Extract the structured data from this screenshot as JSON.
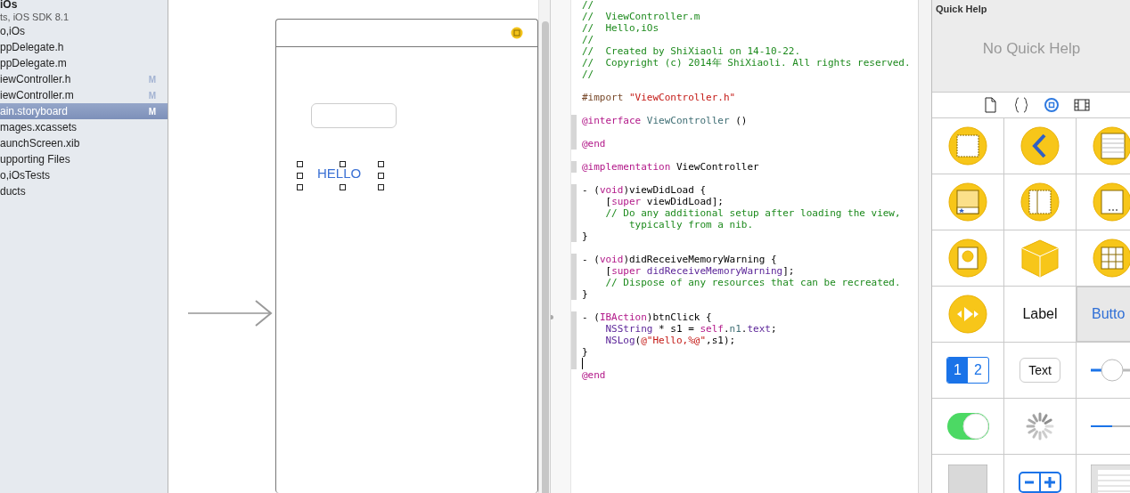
{
  "navigator": {
    "project_title": "iOs",
    "project_subtitle": "ts, iOS SDK 8.1",
    "items": [
      {
        "name": "o,iOs",
        "selected": false
      },
      {
        "name": "ppDelegate.h",
        "selected": false
      },
      {
        "name": "ppDelegate.m",
        "selected": false
      },
      {
        "name": "iewController.h",
        "badge": "M",
        "selected": false
      },
      {
        "name": "iewController.m",
        "badge": "M",
        "selected": false
      },
      {
        "name": "ain.storyboard",
        "badge": "M",
        "selected": true
      },
      {
        "name": "mages.xcassets",
        "selected": false
      },
      {
        "name": "aunchScreen.xib",
        "selected": false
      },
      {
        "name": "upporting Files",
        "selected": false
      },
      {
        "name": "o,iOsTests",
        "selected": false
      },
      {
        "name": "ducts",
        "selected": false
      }
    ]
  },
  "storyboard": {
    "label_text": "HELLO",
    "label_selected": true
  },
  "editor": {
    "lines": [
      {
        "changed": false,
        "tokens": [
          {
            "kind": "comment",
            "text": "//"
          }
        ]
      },
      {
        "changed": false,
        "tokens": [
          {
            "kind": "comment",
            "text": "//  ViewController.m"
          }
        ]
      },
      {
        "changed": false,
        "tokens": [
          {
            "kind": "comment",
            "text": "//  Hello,iOs"
          }
        ]
      },
      {
        "changed": false,
        "tokens": [
          {
            "kind": "comment",
            "text": "//"
          }
        ]
      },
      {
        "changed": false,
        "tokens": [
          {
            "kind": "comment",
            "text": "//  Created by ShiXiaoli on 14-10-22."
          }
        ]
      },
      {
        "changed": false,
        "tokens": [
          {
            "kind": "comment",
            "text": "//  Copyright (c) 2014年 ShiXiaoli. All rights reserved."
          }
        ]
      },
      {
        "changed": false,
        "tokens": [
          {
            "kind": "comment",
            "text": "//"
          }
        ]
      },
      {
        "changed": false
      },
      {
        "changed": false,
        "tokens": [
          {
            "kind": "preproc",
            "text": "#import "
          },
          {
            "kind": "string",
            "text": "\"ViewController.h\""
          }
        ]
      },
      {
        "changed": false
      },
      {
        "changed": true,
        "tokens": [
          {
            "kind": "keyword",
            "text": "@interface"
          },
          {
            "kind": "project",
            "text": " ViewController"
          },
          {
            "kind": "plain",
            "text": " ()"
          }
        ]
      },
      {
        "changed": true
      },
      {
        "changed": true,
        "tokens": [
          {
            "kind": "keyword",
            "text": "@end"
          }
        ]
      },
      {
        "changed": false
      },
      {
        "changed": true,
        "tokens": [
          {
            "kind": "keyword",
            "text": "@implementation"
          },
          {
            "kind": "plain",
            "text": " ViewController"
          }
        ]
      },
      {
        "changed": false
      },
      {
        "changed": true,
        "tokens": [
          {
            "kind": "plain",
            "text": "- ("
          },
          {
            "kind": "keyword",
            "text": "void"
          },
          {
            "kind": "plain",
            "text": ")viewDidLoad {"
          }
        ]
      },
      {
        "changed": true,
        "tokens": [
          {
            "kind": "plain",
            "text": "    ["
          },
          {
            "kind": "keyword",
            "text": "super"
          },
          {
            "kind": "plain",
            "text": " viewDidLoad];"
          }
        ]
      },
      {
        "changed": true,
        "tokens": [
          {
            "kind": "comment",
            "text": "    // Do any additional setup after loading the view,"
          }
        ]
      },
      {
        "changed": true,
        "tokens": [
          {
            "kind": "comment",
            "text": "        typically from a nib."
          }
        ]
      },
      {
        "changed": true,
        "tokens": [
          {
            "kind": "plain",
            "text": "}"
          }
        ]
      },
      {
        "changed": false
      },
      {
        "changed": true,
        "tokens": [
          {
            "kind": "plain",
            "text": "- ("
          },
          {
            "kind": "keyword",
            "text": "void"
          },
          {
            "kind": "plain",
            "text": ")didReceiveMemoryWarning {"
          }
        ]
      },
      {
        "changed": true,
        "tokens": [
          {
            "kind": "plain",
            "text": "    ["
          },
          {
            "kind": "keyword",
            "text": "super"
          },
          {
            "kind": "type",
            "text": " didReceiveMemoryWarning"
          },
          {
            "kind": "plain",
            "text": "];"
          }
        ]
      },
      {
        "changed": true,
        "tokens": [
          {
            "kind": "comment",
            "text": "    // Dispose of any resources that can be recreated."
          }
        ]
      },
      {
        "changed": true,
        "tokens": [
          {
            "kind": "plain",
            "text": "}"
          }
        ]
      },
      {
        "changed": false
      },
      {
        "changed": true,
        "outlet": true,
        "tokens": [
          {
            "kind": "plain",
            "text": "- ("
          },
          {
            "kind": "keyword",
            "text": "IBAction"
          },
          {
            "kind": "plain",
            "text": ")btnClick {"
          }
        ]
      },
      {
        "changed": true,
        "tokens": [
          {
            "kind": "type",
            "text": "    NSString"
          },
          {
            "kind": "plain",
            "text": " * s1 = "
          },
          {
            "kind": "keyword",
            "text": "self"
          },
          {
            "kind": "plain",
            "text": "."
          },
          {
            "kind": "project",
            "text": "n1"
          },
          {
            "kind": "plain",
            "text": "."
          },
          {
            "kind": "type",
            "text": "text"
          },
          {
            "kind": "plain",
            "text": ";"
          }
        ]
      },
      {
        "changed": true,
        "tokens": [
          {
            "kind": "type",
            "text": "    NSLog"
          },
          {
            "kind": "plain",
            "text": "("
          },
          {
            "kind": "string",
            "text": "@\"Hello,%@\""
          },
          {
            "kind": "plain",
            "text": ",s1);"
          }
        ]
      },
      {
        "changed": true,
        "tokens": [
          {
            "kind": "plain",
            "text": "}"
          }
        ]
      },
      {
        "changed": true,
        "cursor": true
      },
      {
        "changed": false,
        "tokens": [
          {
            "kind": "keyword",
            "text": "@end"
          }
        ]
      }
    ]
  },
  "utilities": {
    "title": "Quick Help",
    "message": "No Quick Help",
    "library_tabs": [
      {
        "kind": "file",
        "selected": false
      },
      {
        "kind": "braces",
        "selected": false
      },
      {
        "kind": "object",
        "selected": true
      },
      {
        "kind": "media",
        "selected": false
      }
    ],
    "library": [
      {
        "kind": "view-controller"
      },
      {
        "kind": "navigation-controller"
      },
      {
        "kind": "table-view-controller"
      },
      {
        "kind": "tab-bar-controller"
      },
      {
        "kind": "split-view-controller"
      },
      {
        "kind": "collection-view-controller"
      },
      {
        "kind": "media-controller"
      },
      {
        "kind": "object"
      },
      {
        "kind": "grid-view"
      },
      {
        "kind": "player"
      },
      {
        "kind": "label",
        "text": "Label"
      },
      {
        "kind": "button",
        "text": "Butto"
      },
      {
        "kind": "segmented",
        "segments": [
          "1",
          "2"
        ]
      },
      {
        "kind": "text-field",
        "text": "Text"
      },
      {
        "kind": "slider"
      },
      {
        "kind": "switch"
      },
      {
        "kind": "spinner"
      },
      {
        "kind": "progress"
      },
      {
        "kind": "page-control"
      },
      {
        "kind": "stepper"
      },
      {
        "kind": "table-view"
      }
    ]
  }
}
